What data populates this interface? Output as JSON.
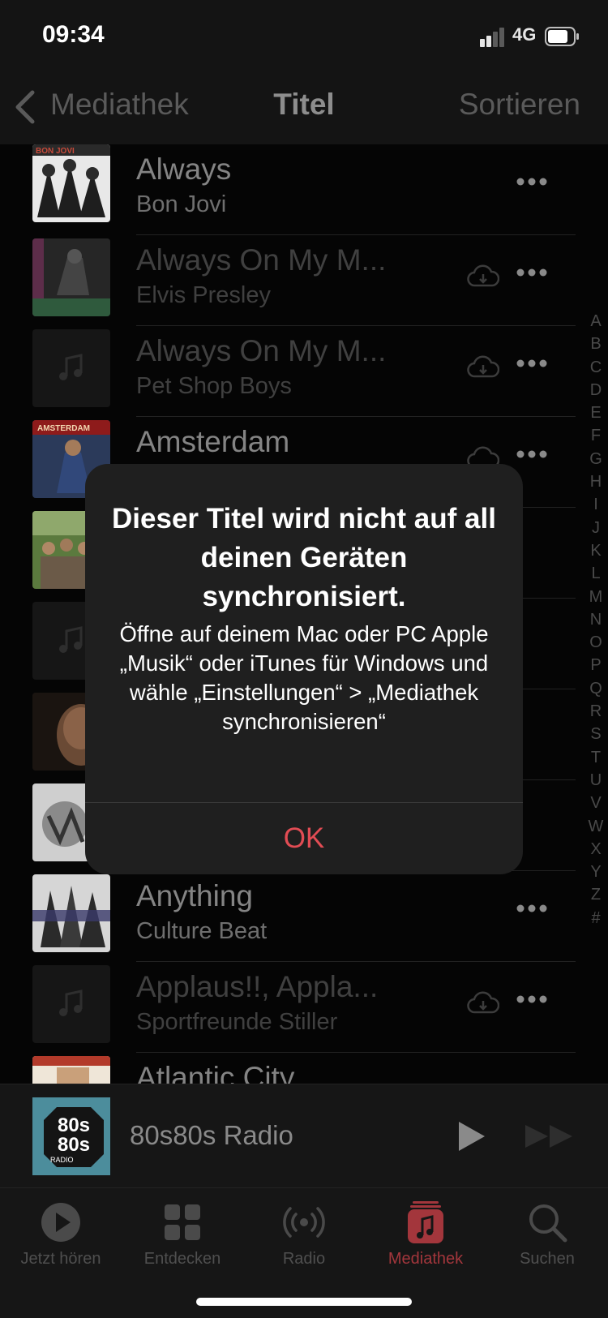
{
  "status": {
    "time": "09:34",
    "network": "4G"
  },
  "nav": {
    "back_label": "Mediathek",
    "title": "Titel",
    "sort_label": "Sortieren"
  },
  "songs": [
    {
      "title": "Always",
      "artist": "Bon Jovi",
      "art": "bon-jovi-cover",
      "cloud": false,
      "dim": false
    },
    {
      "title": "Always On My M...",
      "artist": "Elvis Presley",
      "art": "elvis-presley-cover",
      "cloud": true,
      "dim": true
    },
    {
      "title": "Always On My M...",
      "artist": "Pet Shop Boys",
      "art": "placeholder-note",
      "cloud": true,
      "dim": true
    },
    {
      "title": "Amsterdam",
      "artist": "",
      "art": "amsterdam-cover",
      "cloud": true,
      "dim": false
    },
    {
      "title": "",
      "artist": "",
      "art": "kelly-family-cover",
      "cloud": false,
      "dim": false
    },
    {
      "title": "",
      "artist": "",
      "art": "placeholder-note",
      "cloud": false,
      "dim": false
    },
    {
      "title": "",
      "artist": "",
      "art": "portrait-cover",
      "cloud": false,
      "dim": false
    },
    {
      "title": "",
      "artist": "",
      "art": "snow-cover",
      "cloud": false,
      "dim": false
    },
    {
      "title": "Anything",
      "artist": "Culture Beat",
      "art": "culture-beat-cover",
      "cloud": false,
      "dim": false
    },
    {
      "title": "Applaus!!, Appla...",
      "artist": "Sportfreunde Stiller",
      "art": "placeholder-note",
      "cloud": true,
      "dim": true
    },
    {
      "title": "Atlantic City",
      "artist": "",
      "art": "bruce-springsteen-cover",
      "cloud": false,
      "dim": false
    }
  ],
  "index_letters": [
    "A",
    "B",
    "C",
    "D",
    "E",
    "F",
    "G",
    "H",
    "I",
    "J",
    "K",
    "L",
    "M",
    "N",
    "O",
    "P",
    "Q",
    "R",
    "S",
    "T",
    "U",
    "V",
    "W",
    "X",
    "Y",
    "Z",
    "#"
  ],
  "dialog": {
    "title": "Dieser Titel wird nicht auf all deinen Geräten synchronisiert.",
    "message": "Öffne auf deinem Mac oder PC Apple „Musik“ oder iTunes für Windows und wähle „Einstellungen“ > „Mediathek synchronisieren“",
    "ok_label": "OK",
    "ok_color": "#e24c54"
  },
  "miniplayer": {
    "title": "80s80s Radio",
    "art_text": [
      "80s",
      "80s",
      "RADIO"
    ]
  },
  "tabs": [
    {
      "label": "Jetzt hören",
      "icon": "play-circle-icon",
      "active": false
    },
    {
      "label": "Entdecken",
      "icon": "grid-icon",
      "active": false
    },
    {
      "label": "Radio",
      "icon": "radio-waves-icon",
      "active": false
    },
    {
      "label": "Mediathek",
      "icon": "music-library-icon",
      "active": true
    },
    {
      "label": "Suchen",
      "icon": "search-icon",
      "active": false
    }
  ],
  "colors": {
    "accent": "#e24c54",
    "background": "#000000",
    "dialog": "#1f1f1f"
  }
}
